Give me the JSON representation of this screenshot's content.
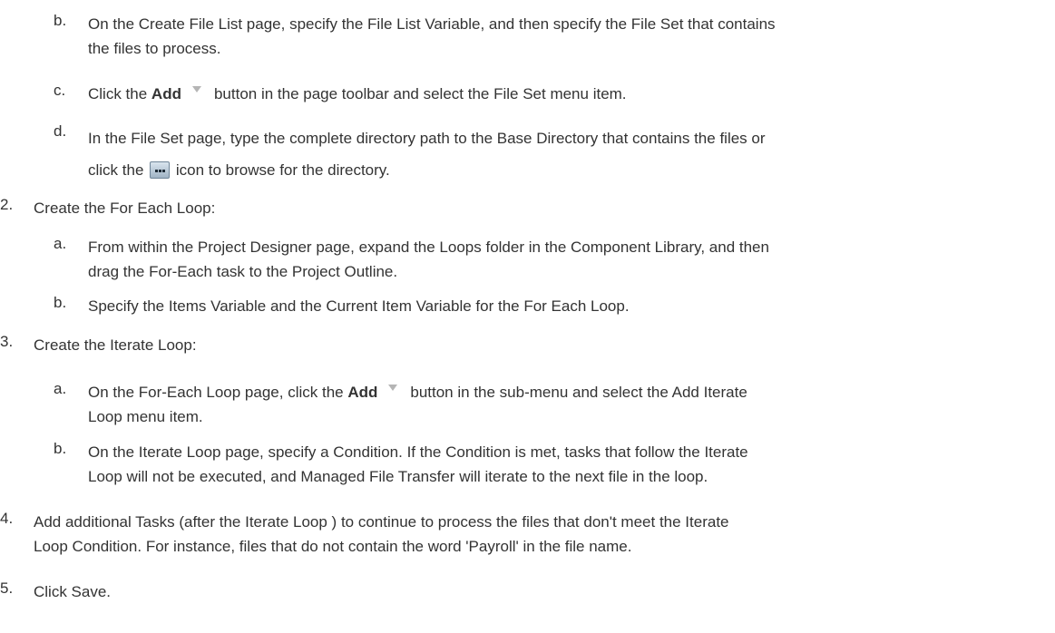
{
  "steps": [
    {
      "marker": "b.",
      "lines": [
        "On the Create File List page, specify the File List Variable, and then specify the File Set that contains",
        "the files to process."
      ]
    },
    {
      "marker": "c.",
      "pre": "Click the ",
      "bold": "Add",
      "icon": "dropdown-arrow-icon",
      "post": "button in the page toolbar and select the File Set menu item."
    },
    {
      "marker": "d.",
      "line1": "In the File Set page, type the complete directory path to the Base Directory that contains the files or",
      "line2_pre": "click the ",
      "icon": "browse-ellipsis-icon",
      "line2_post": " icon to browse for the directory."
    },
    {
      "marker": "2.",
      "text": "Create the For Each Loop:"
    },
    {
      "marker": "a.",
      "lines": [
        "From within the Project Designer page, expand the Loops folder in the Component Library, and then",
        "drag the For-Each task to the Project Outline."
      ]
    },
    {
      "marker": "b.",
      "text": "Specify the Items Variable and the Current Item Variable for the For Each Loop."
    },
    {
      "marker": "3.",
      "text": "Create the Iterate Loop:"
    },
    {
      "marker": "a.",
      "pre": "On the For-Each Loop page, click the ",
      "bold": "Add",
      "icon": "dropdown-arrow-icon",
      "post": "button in the sub-menu and select the Add Iterate",
      "line2": "Loop menu item."
    },
    {
      "marker": "b.",
      "lines": [
        "On the Iterate Loop page, specify a Condition. If the Condition is met, tasks that follow the Iterate",
        "Loop will not be executed, and Managed File Transfer will iterate to the next file in the loop."
      ]
    },
    {
      "marker": "4.",
      "lines": [
        "Add additional Tasks (after the Iterate Loop ) to continue to process the files that don't meet the Iterate",
        "Loop Condition. For instance, files that do not contain the word 'Payroll' in the file name."
      ]
    },
    {
      "marker": "5.",
      "text": "Click Save."
    }
  ]
}
